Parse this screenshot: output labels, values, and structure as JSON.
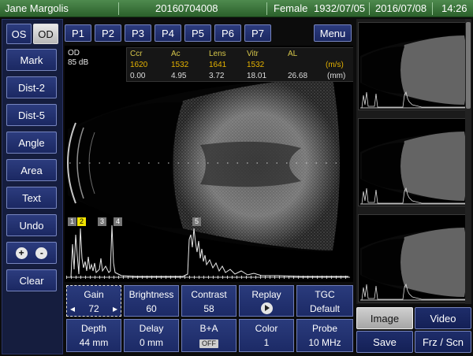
{
  "titlebar": {
    "patient": "Jane Margolis",
    "id": "20160704008",
    "sex": "Female",
    "dob": "1932/07/05",
    "date": "2016/07/08",
    "time": "14:26"
  },
  "eye_tabs": [
    "OS",
    "OD"
  ],
  "eye_selected": "OD",
  "presets": [
    "P1",
    "P2",
    "P3",
    "P4",
    "P5",
    "P6",
    "P7"
  ],
  "menu_label": "Menu",
  "tools": [
    "Mark",
    "Dist-2",
    "Dist-5",
    "Angle",
    "Area",
    "Text",
    "Undo"
  ],
  "zoom": {
    "plus": "+",
    "minus": "-"
  },
  "clear_label": "Clear",
  "image_meta": {
    "eye": "OD",
    "gain_db": "85 dB"
  },
  "measurements": {
    "headers": [
      "Ccr",
      "Ac",
      "Lens",
      "Vitr",
      "AL"
    ],
    "velocity": [
      "1620",
      "1532",
      "1641",
      "1532"
    ],
    "velocity_unit": "(m/s)",
    "lengths": [
      "0.00",
      "4.95",
      "3.72",
      "18.01",
      "26.68"
    ],
    "length_unit": "(mm)"
  },
  "echo_markers": [
    "1",
    "2",
    "3",
    "4",
    "5"
  ],
  "echo_marker_selected": "2",
  "controls": {
    "gain": {
      "label": "Gain",
      "value": "72",
      "left": "◂",
      "right": "▸"
    },
    "brightness": {
      "label": "Brightness",
      "value": "60"
    },
    "contrast": {
      "label": "Contrast",
      "value": "58"
    },
    "replay": {
      "label": "Replay"
    },
    "tgc": {
      "label": "TGC",
      "value": "Default"
    },
    "depth": {
      "label": "Depth",
      "value": "44 mm"
    },
    "delay": {
      "label": "Delay",
      "value": "0 mm"
    },
    "bplusa": {
      "label": "B+A",
      "value": "OFF"
    },
    "color": {
      "label": "Color",
      "value": "1"
    },
    "probe": {
      "label": "Probe",
      "value": "10 MHz"
    }
  },
  "actions": {
    "image": "Image",
    "video": "Video",
    "save": "Save",
    "frz": "Frz / Scn"
  },
  "colors": {
    "titlebar": "#3f7a3f",
    "button": "#243370",
    "selected": "#d0d0d0",
    "marker_selected": "#f2e300"
  }
}
